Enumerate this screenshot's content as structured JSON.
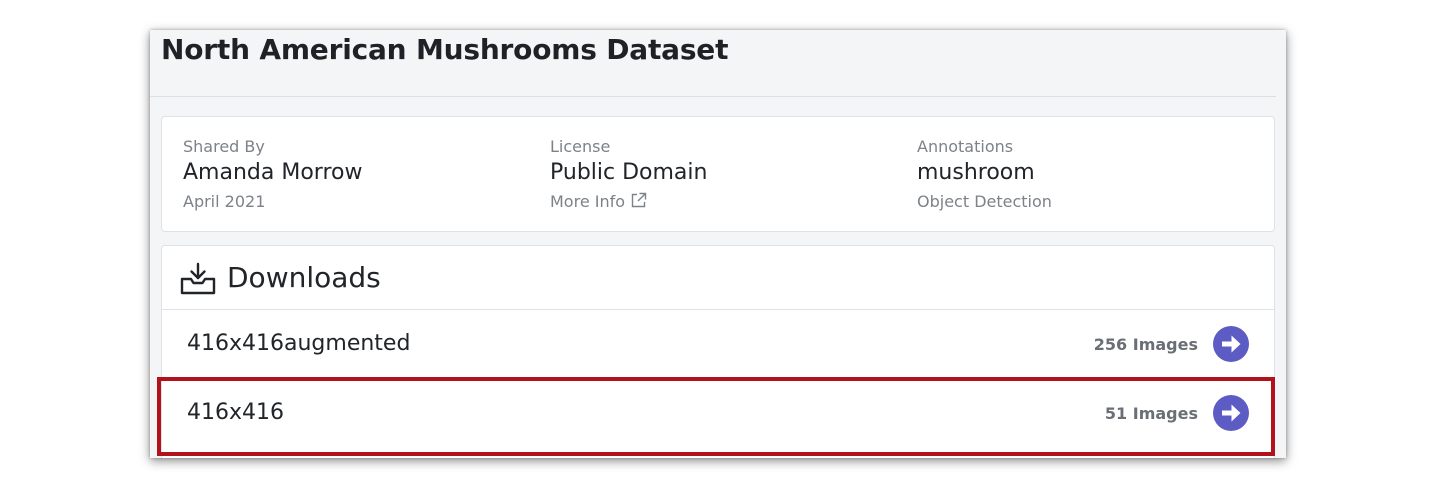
{
  "dataset": {
    "title": "North American Mushrooms Dataset"
  },
  "info": {
    "shared_by": {
      "label": "Shared By",
      "value": "Amanda Morrow",
      "sub": "April 2021"
    },
    "license": {
      "label": "License",
      "value": "Public Domain",
      "sub": "More Info"
    },
    "annotations": {
      "label": "Annotations",
      "value": "mushroom",
      "sub": "Object Detection"
    }
  },
  "downloads": {
    "title": "Downloads",
    "items": [
      {
        "name": "416x416augmented",
        "count": "256 Images"
      },
      {
        "name": "416x416",
        "count": "51 Images"
      }
    ]
  },
  "icons": {
    "downloads": "download-tray-icon",
    "more_info": "external-link-icon",
    "go": "arrow-right-circle-icon"
  },
  "colors": {
    "accent": "#5c5cc4",
    "highlight": "#b1121b"
  }
}
